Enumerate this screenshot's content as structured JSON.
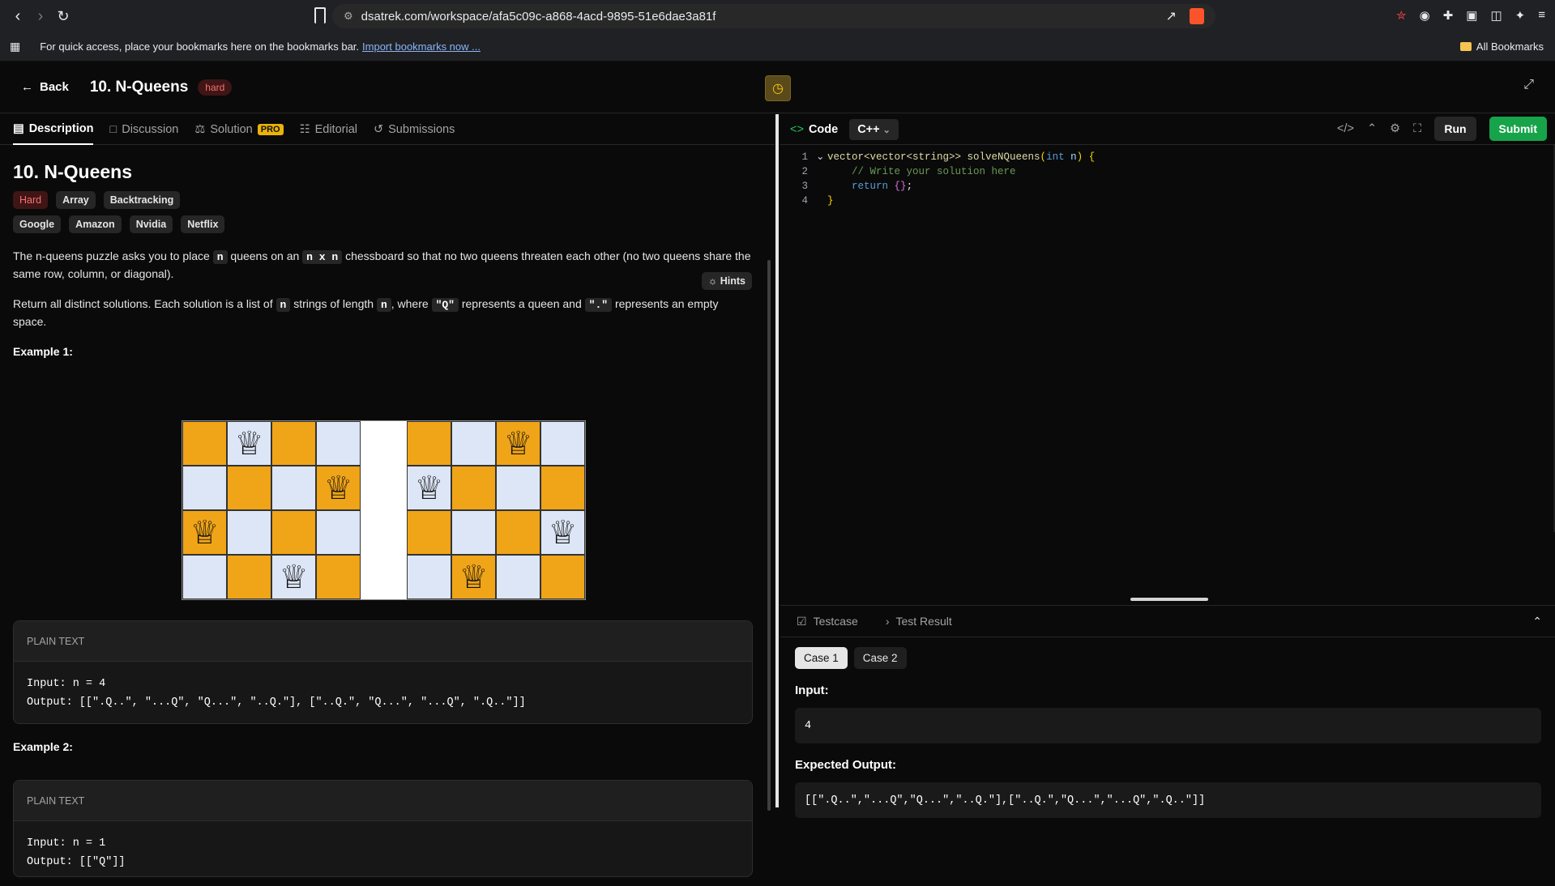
{
  "browser": {
    "url": "dsatrek.com/workspace/afa5c09c-a868-4acd-9895-51e6dae3a81f",
    "brave_badge": "2",
    "bookmarks_prompt": "For quick access, place your bookmarks here on the bookmarks bar.",
    "import_link": "Import bookmarks now ...",
    "all_bookmarks": "All Bookmarks"
  },
  "header": {
    "back_label": "Back",
    "title": "10. N-Queens",
    "difficulty": "hard"
  },
  "left_tabs": [
    {
      "label": "Description"
    },
    {
      "label": "Discussion"
    },
    {
      "label": "Solution"
    },
    {
      "label": "Editorial"
    },
    {
      "label": "Submissions"
    }
  ],
  "solution_badge": "PRO",
  "problem": {
    "title": "10. N-Queens",
    "difficulty_tag": "Hard",
    "topic_tags": [
      "Array",
      "Backtracking"
    ],
    "company_tags": [
      "Google",
      "Amazon",
      "Nvidia",
      "Netflix"
    ],
    "hints_label": "Hints",
    "p1_a": "The n-queens puzzle asks you to place",
    "p1_code1": "n",
    "p1_b": "queens on an",
    "p1_code2": "n x n",
    "p1_c": "chessboard so that no two queens threaten each other (no two queens share the same row, column, or diagonal).",
    "p2_a": "Return all distinct solutions. Each solution is a list of",
    "p2_code1": "n",
    "p2_b": "strings of length",
    "p2_code2": "n",
    "p2_c": ", where",
    "p2_code3": "\"Q\"",
    "p2_d": "represents a queen and",
    "p2_code4": "\".\"",
    "p2_e": "represents an empty space.",
    "example1_heading": "Example 1:",
    "example1_box_label": "PLAIN TEXT",
    "example1_input": "Input: n = 4",
    "example1_output": "Output: [[\".Q..\", \"...Q\", \"Q...\", \"..Q.\"], [\"..Q.\", \"Q...\", \"...Q\", \".Q..\"]]",
    "example2_heading": "Example 2:",
    "example2_box_label": "PLAIN TEXT",
    "example2_input": "Input: n = 1",
    "example2_output": "Output: [[\"Q\"]]"
  },
  "boards": [
    {
      "queens": [
        1,
        3,
        0,
        2
      ]
    },
    {
      "queens": [
        2,
        0,
        3,
        1
      ]
    }
  ],
  "editor": {
    "code_label": "Code",
    "language": "C++",
    "run_label": "Run",
    "submit_label": "Submit",
    "lines": [
      {
        "num": "1",
        "text": "vector<vector<string>> solveNQueens(int n) {"
      },
      {
        "num": "2",
        "text": "    // Write your solution here"
      },
      {
        "num": "3",
        "text": "    return {};"
      },
      {
        "num": "4",
        "text": "}"
      }
    ]
  },
  "testpanel": {
    "testcase_tab": "Testcase",
    "result_tab": "Test Result",
    "cases": [
      "Case 1",
      "Case 2"
    ],
    "input_label": "Input:",
    "input_value": "4",
    "expected_label": "Expected Output:",
    "expected_value": "[[\".Q..\",\"...Q\",\"Q...\",\"..Q.\"],[\"..Q.\",\"Q...\",\"...Q\",\".Q..\"]]"
  },
  "colors": {
    "submit_green": "#16a34a",
    "hard_red": "#f87171",
    "board_orange": "#f0a417",
    "board_light": "#dde6f6",
    "timer_yellow": "#facc15"
  }
}
